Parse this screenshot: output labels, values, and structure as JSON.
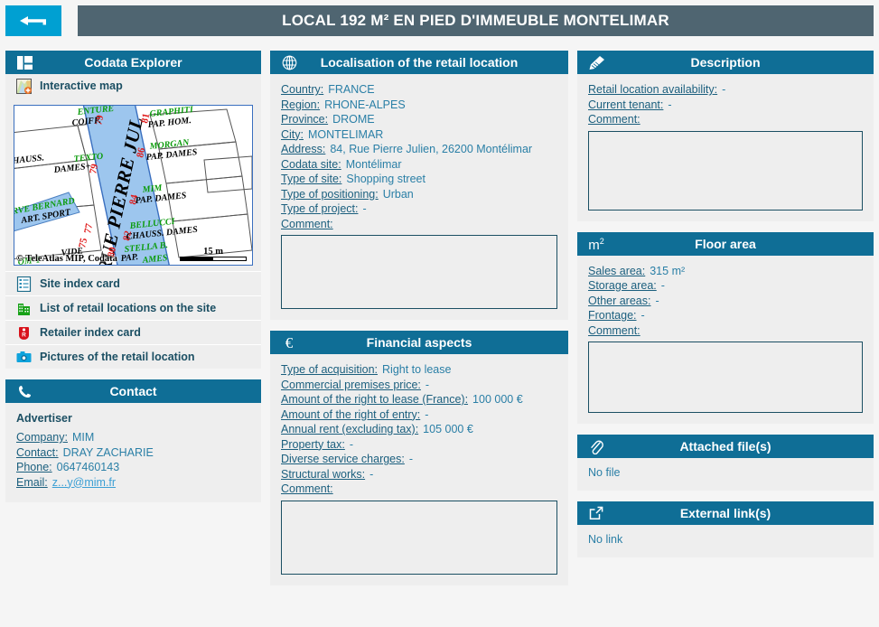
{
  "header": {
    "back_label": "back-arrow",
    "title": "LOCAL 192 M² EN PIED D'IMMEUBLE MONTELIMAR"
  },
  "sidebar": {
    "explorer": {
      "title": "Codata Explorer",
      "icon": "window-layout-icon",
      "items": [
        {
          "label": "Interactive map",
          "icon": "interactive-map-icon"
        },
        {
          "label": "Site index card",
          "icon": "document-list-icon"
        },
        {
          "label": "List of retail locations on the site",
          "icon": "building-icon"
        },
        {
          "label": "Retailer index card",
          "icon": "price-tag-icon"
        },
        {
          "label": "Pictures of the retail location",
          "icon": "camera-icon"
        }
      ]
    },
    "map": {
      "street_name": "RUE PIERRE JUL",
      "attribution": "© TeleAtlas MIP, Codata",
      "scale_label": "15 m",
      "numbers": [
        "79",
        "79",
        "81",
        "86",
        "84",
        "82",
        "80",
        "77",
        "75"
      ],
      "shops": [
        {
          "name": "COIFF.",
          "type": ""
        },
        {
          "name": "TEXTO",
          "type": "DAMES+"
        },
        {
          "name": "HAUSS.",
          "type": ""
        },
        {
          "name": "GRAPHITI",
          "type": "PAP. HOM."
        },
        {
          "name": "MORGAN",
          "type": "PAP. DAMES"
        },
        {
          "name": "MIM",
          "type": "PAP. DAMES"
        },
        {
          "name": "BELLUCCI",
          "type": "CHAUSS. DAMES"
        },
        {
          "name": "STELLA B.",
          "type": "PAP."
        },
        {
          "name": "RVE BERNARD",
          "type": "ART. SPORT"
        },
        {
          "name": "VIDE",
          "type": ""
        }
      ]
    },
    "contact": {
      "title": "Contact",
      "icon": "phone-icon",
      "advertiser_heading": "Advertiser",
      "fields": [
        {
          "label": "Company:",
          "value": "MIM"
        },
        {
          "label": "Contact:",
          "value": "DRAY ZACHARIE"
        },
        {
          "label": "Phone:",
          "value": "0647460143"
        }
      ],
      "email_label": "Email:",
      "email_value": "z...y@mim.fr"
    }
  },
  "localisation": {
    "title": "Localisation of the retail location",
    "icon": "globe-icon",
    "fields": [
      {
        "label": "Country:",
        "value": "FRANCE"
      },
      {
        "label": "Region:",
        "value": "RHONE-ALPES"
      },
      {
        "label": "Province:",
        "value": "DROME"
      },
      {
        "label": "City:",
        "value": "MONTELIMAR"
      },
      {
        "label": "Address:",
        "value": "84, Rue Pierre Julien, 26200 Montélimar"
      },
      {
        "label": "Codata site:",
        "value": "Montélimar"
      },
      {
        "label": "Type of site:",
        "value": "Shopping street"
      },
      {
        "label": "Type of positioning:",
        "value": "Urban"
      },
      {
        "label": "Type of project:",
        "value": "-"
      }
    ],
    "comment_label": "Comment:"
  },
  "financial": {
    "title": "Financial aspects",
    "icon": "euro-icon",
    "fields": [
      {
        "label": "Type of acquisition:",
        "value": "Right to lease"
      },
      {
        "label": "Commercial premises price:",
        "value": "-"
      },
      {
        "label": "Amount of the right to lease (France):",
        "value": "100 000 €"
      },
      {
        "label": "Amount of the right of entry:",
        "value": "-"
      },
      {
        "label": "Annual rent (excluding tax):",
        "value": "105 000 €"
      },
      {
        "label": "Property tax:",
        "value": "-"
      },
      {
        "label": "Diverse service charges:",
        "value": "-"
      },
      {
        "label": "Structural works:",
        "value": "-"
      }
    ],
    "comment_label": "Comment:"
  },
  "description": {
    "title": "Description",
    "icon": "pencil-icon",
    "fields": [
      {
        "label": "Retail location availability:",
        "value": "-"
      },
      {
        "label": "Current tenant:",
        "value": "-"
      }
    ],
    "comment_label": "Comment:"
  },
  "floor_area": {
    "title": "Floor area",
    "icon": "m2-icon",
    "fields": [
      {
        "label": "Sales area:",
        "value": "315 m²"
      },
      {
        "label": "Storage area:",
        "value": "-"
      },
      {
        "label": "Other areas:",
        "value": "-"
      },
      {
        "label": "Frontage:",
        "value": "-"
      }
    ],
    "comment_label": "Comment:"
  },
  "attached_files": {
    "title": "Attached file(s)",
    "icon": "paperclip-icon",
    "empty_text": "No file"
  },
  "external_links": {
    "title": "External link(s)",
    "icon": "external-link-icon",
    "empty_text": "No link"
  },
  "colors": {
    "panel_header": "#0f6e96",
    "title_bar": "#4f6571",
    "back_button": "#00a0d2",
    "label_text": "#1b5f7e",
    "value_text": "#2a7fa6",
    "panel_bg": "#eeeeee",
    "page_bg": "#f5f5f5"
  }
}
